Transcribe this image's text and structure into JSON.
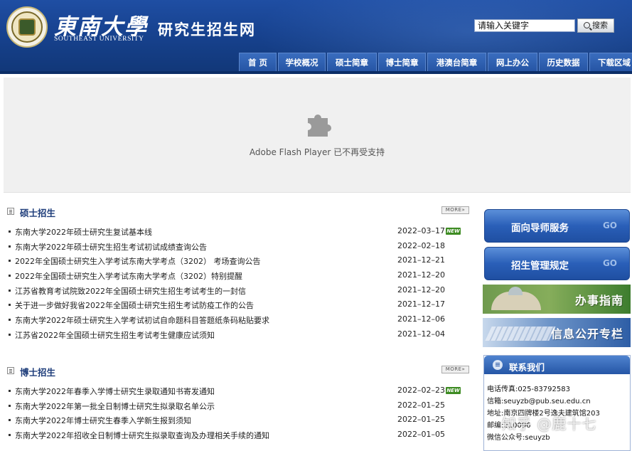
{
  "header": {
    "logo_cn": "東南大學",
    "logo_en": "SOUTHEAST UNIVERSITY",
    "site_title": "研究生招生网",
    "search": {
      "value": "请输入关键字",
      "button": "搜索"
    }
  },
  "nav": [
    {
      "label": "首 页"
    },
    {
      "label": "学校概况"
    },
    {
      "label": "硕士简章"
    },
    {
      "label": "博士简章"
    },
    {
      "label": "港澳台简章"
    },
    {
      "label": "网上办公"
    },
    {
      "label": "历史数据"
    },
    {
      "label": "下载区域"
    }
  ],
  "flash": {
    "message": "Adobe Flash Player 已不再受支持"
  },
  "master": {
    "title": "硕士招生",
    "more": "MORE»",
    "items": [
      {
        "title": "东南大学2022年硕士研究生复试基本线",
        "date": "2022–03–17",
        "new": "NEW"
      },
      {
        "title": "东南大学2022年硕士研究生招生考试初试成绩查询公告",
        "date": "2022–02–18"
      },
      {
        "title": "2022年全国硕士研究生入学考试东南大学考点（3202） 考场查询公告",
        "date": "2021–12–21"
      },
      {
        "title": "2022年全国硕士研究生入学考试东南大学考点（3202）特别提醒",
        "date": "2021–12–20"
      },
      {
        "title": "江苏省教育考试院致2022年全国硕士研究生招生考试考生的一封信",
        "date": "2021–12–20"
      },
      {
        "title": "关于进一步做好我省2022年全国硕士研究生招生考试防疫工作的公告",
        "date": "2021–12–17"
      },
      {
        "title": "东南大学2022年硕士研究生入学考试初试自命题科目答题纸条码粘贴要求",
        "date": "2021–12–06"
      },
      {
        "title": "江苏省2022年全国硕士研究生招生考试考生健康应试须知",
        "date": "2021–12–04"
      }
    ]
  },
  "doctor": {
    "title": "博士招生",
    "more": "MORE»",
    "items": [
      {
        "title": "东南大学2022年春季入学博士研究生录取通知书寄发通知",
        "date": "2022–02–23",
        "new": "NEW"
      },
      {
        "title": "东南大学2022年第一批全日制博士研究生拟录取名单公示",
        "date": "2022–01–25"
      },
      {
        "title": "东南大学2022年博士研究生春季入学新生报到须知",
        "date": "2022–01–25"
      },
      {
        "title": "东南大学2022年招收全日制博士研究生拟录取查询及办理相关手续的通知",
        "date": "2022–01–05"
      }
    ]
  },
  "sidebar": {
    "buttons": [
      {
        "label": "面向导师服务",
        "go": "GO"
      },
      {
        "label": "招生管理规定",
        "go": "GO"
      }
    ],
    "banners": [
      {
        "label": "办事指南"
      },
      {
        "label": "信息公开专栏"
      }
    ],
    "contact": {
      "title": "联系我们",
      "lines": [
        "电话传真:025-83792583",
        "信箱:seuyzb@pub.seu.edu.cn",
        "地址:南京四牌楼2号逸夫建筑馆203",
        "邮编:210096",
        "微信公众号:seuyzb"
      ]
    }
  },
  "watermark": "知乎 @鹿十七",
  "colors": {
    "header_blue": "#17428f",
    "nav_tab": "#2554a3",
    "section_title": "#1d3c7a",
    "new_badge": "#3d8b22"
  }
}
